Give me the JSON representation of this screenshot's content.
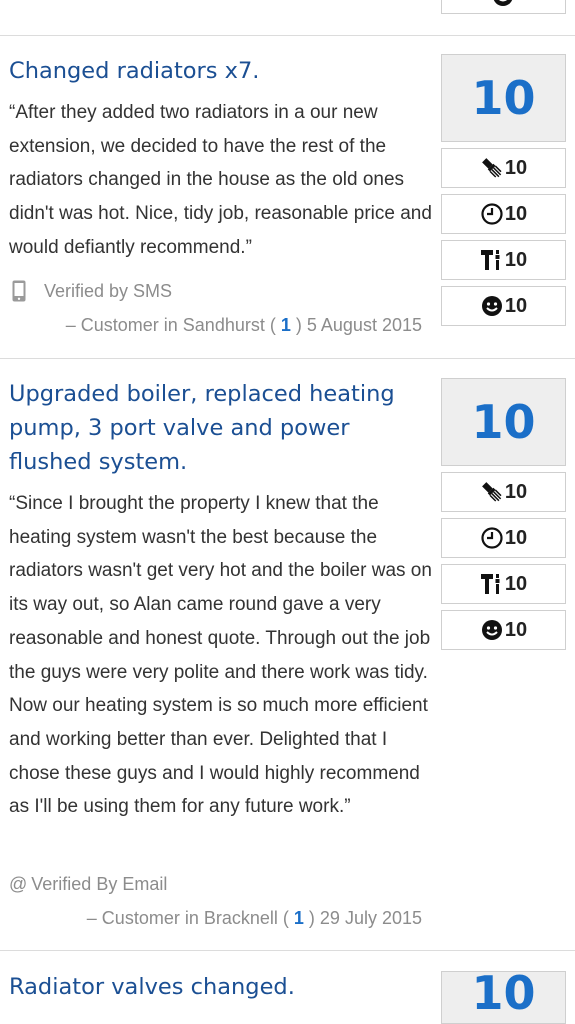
{
  "reviews": [
    {
      "title": "Changed radiators x7.",
      "body": "“After they added two radiators in a our new extension, we decided to have the rest of the radiators changed in the house as the old ones didn't was hot. Nice, tidy job, reasonable price and would defiantly recommend.”",
      "verified": "Verified by SMS",
      "customer_prefix": "– Customer in Sandhurst (",
      "customer_count": "1",
      "customer_suffix": ") 5 August 2015",
      "overall": "10",
      "scores": {
        "workmanship": "10",
        "timekeeping": "10",
        "tidiness": "10",
        "courtesy": "10"
      }
    },
    {
      "title": "Upgraded boiler, replaced heating pump, 3 port valve and power flushed system.",
      "body": "“Since I brought the property I knew that the heating system wasn't the best because the radiators wasn't get very hot and the boiler was on its way out, so Alan came round gave a very reasonable and honest quote. Through out the job the guys were very polite and there work was tidy. Now our heating system is so much more efficient and working better than ever. Delighted that I chose these guys and I would highly recommend as I'll be using them for any future work.”",
      "verified": "Verified By Email",
      "customer_prefix": "– Customer in Bracknell (",
      "customer_count": "1",
      "customer_suffix": ") 29 July 2015",
      "overall": "10",
      "scores": {
        "workmanship": "10",
        "timekeeping": "10",
        "tidiness": "10",
        "courtesy": "10"
      }
    },
    {
      "title": "Radiator valves changed.",
      "overall": "10"
    }
  ],
  "icons": {
    "workmanship": "brush-icon",
    "timekeeping": "clock-icon",
    "tidiness": "tools-icon",
    "courtesy": "smiley-icon",
    "sms": "phone-icon",
    "email": "at-icon"
  },
  "colors": {
    "title": "#1b4f93",
    "score": "#1b6fc8",
    "meta": "#8c8c8c"
  }
}
